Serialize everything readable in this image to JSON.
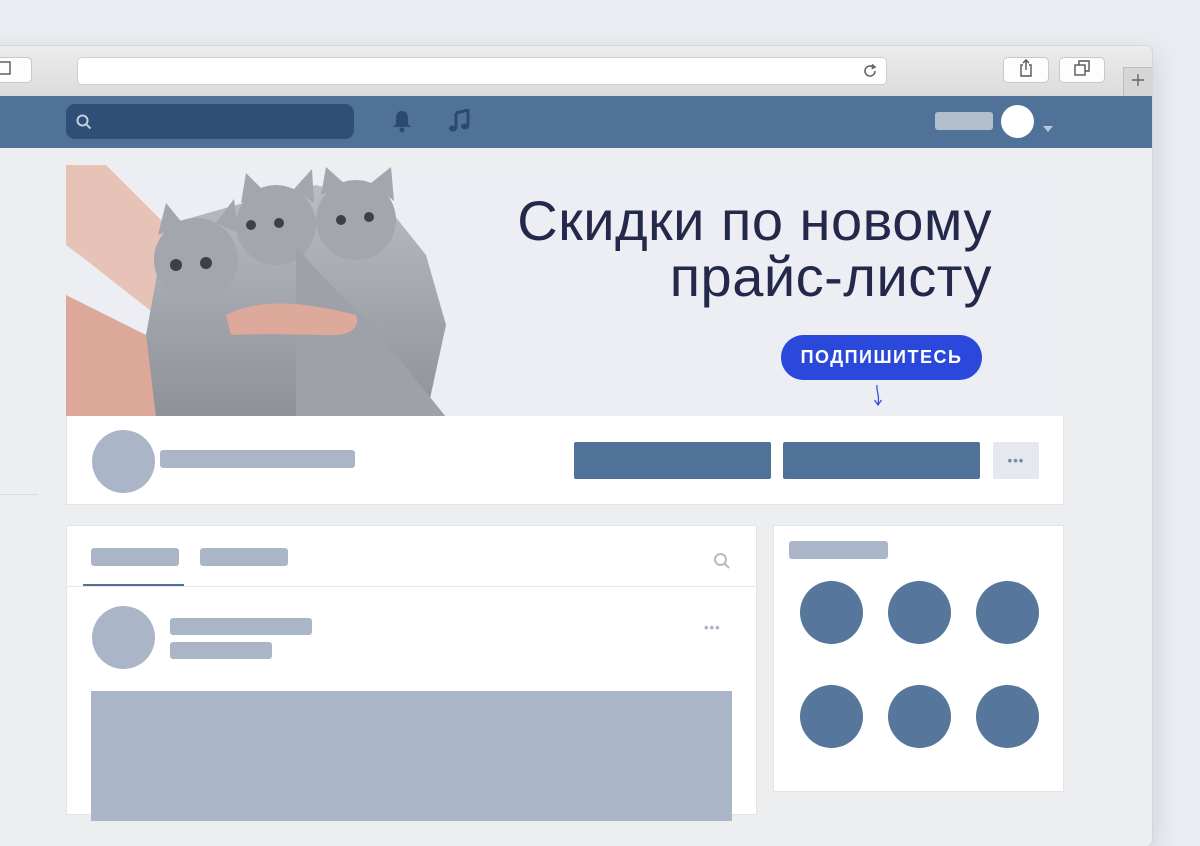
{
  "browser": {
    "sidebar_icon": "sidebar-icon",
    "reload_icon": "reload-icon",
    "share_icon": "share-icon",
    "tabs_icon": "tabs-icon",
    "new_tab_icon": "plus-icon"
  },
  "navbar": {
    "icons": [
      "search-icon",
      "bell-icon",
      "music-note-icon",
      "chevron-down-icon"
    ],
    "colors": {
      "bar": "#507299",
      "search": "#2f4f77"
    }
  },
  "cover": {
    "headline_line1": "Скидки по новому",
    "headline_line2": "прайс-листу",
    "cta_label": "ПОДПИШИТЕСЬ",
    "colors": {
      "cta": "#2a49db",
      "headline": "#24284a"
    }
  },
  "post": {
    "more_label": "•••"
  },
  "profile": {
    "more_label": "•••"
  }
}
